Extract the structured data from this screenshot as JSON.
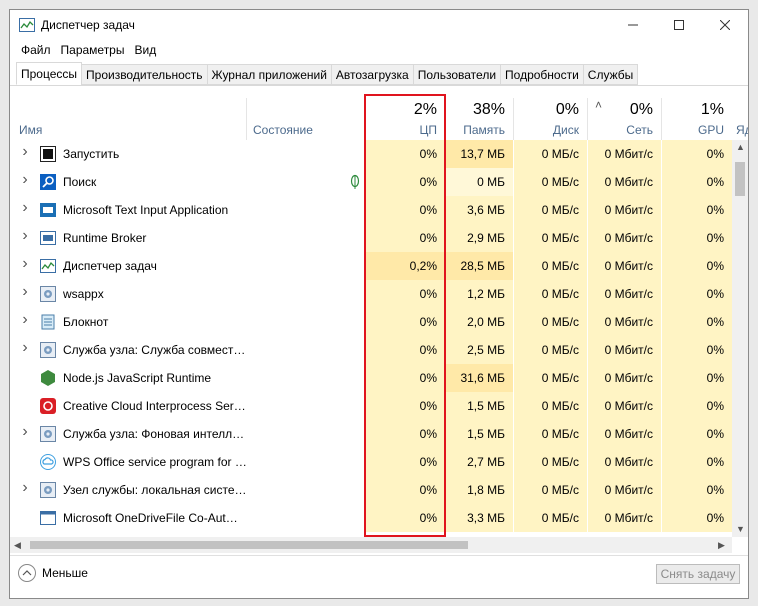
{
  "window": {
    "title": "Диспетчер задач"
  },
  "menu": [
    "Файл",
    "Параметры",
    "Вид"
  ],
  "tabs": [
    "Процессы",
    "Производительность",
    "Журнал приложений",
    "Автозагрузка",
    "Пользователи",
    "Подробности",
    "Службы"
  ],
  "columns": {
    "name": "Имя",
    "status": "Состояние",
    "cpu": {
      "pct": "2%",
      "label": "ЦП"
    },
    "memory": {
      "pct": "38%",
      "label": "Память"
    },
    "disk": {
      "pct": "0%",
      "label": "Диск"
    },
    "network": {
      "pct": "0%",
      "label": "Сеть"
    },
    "gpu": {
      "pct": "1%",
      "label": "GPU"
    },
    "gpu_engine_partial": "Яд"
  },
  "processes": [
    {
      "name": "Запустить",
      "expandable": true,
      "icon": "start-icon",
      "cpu": "0%",
      "memory": "13,7 МБ",
      "disk": "0 МБ/с",
      "network": "0 Мбит/с",
      "gpu": "0%"
    },
    {
      "name": "Поиск",
      "expandable": true,
      "icon": "search-app-icon",
      "suspended": true,
      "cpu": "0%",
      "memory": "0 МБ",
      "disk": "0 МБ/с",
      "network": "0 Мбит/с",
      "gpu": "0%"
    },
    {
      "name": "Microsoft Text Input Application",
      "expandable": true,
      "icon": "text-input-icon",
      "cpu": "0%",
      "memory": "3,6 МБ",
      "disk": "0 МБ/с",
      "network": "0 Мбит/с",
      "gpu": "0%"
    },
    {
      "name": "Runtime Broker",
      "expandable": true,
      "icon": "runtime-broker-icon",
      "cpu": "0%",
      "memory": "2,9 МБ",
      "disk": "0 МБ/с",
      "network": "0 Мбит/с",
      "gpu": "0%"
    },
    {
      "name": "Диспетчер задач",
      "expandable": true,
      "icon": "task-manager-icon",
      "cpu": "0,2%",
      "memory": "28,5 МБ",
      "disk": "0 МБ/с",
      "network": "0 Мбит/с",
      "gpu": "0%"
    },
    {
      "name": "wsappx",
      "expandable": true,
      "icon": "gear-icon",
      "cpu": "0%",
      "memory": "1,2 МБ",
      "disk": "0 МБ/с",
      "network": "0 Мбит/с",
      "gpu": "0%"
    },
    {
      "name": "Блокнот",
      "expandable": true,
      "icon": "notepad-icon",
      "cpu": "0%",
      "memory": "2,0 МБ",
      "disk": "0 МБ/с",
      "network": "0 Мбит/с",
      "gpu": "0%"
    },
    {
      "name": "Служба узла: Служба совмест…",
      "expandable": true,
      "icon": "gear-icon",
      "cpu": "0%",
      "memory": "2,5 МБ",
      "disk": "0 МБ/с",
      "network": "0 Мбит/с",
      "gpu": "0%"
    },
    {
      "name": "Node.js JavaScript Runtime",
      "expandable": false,
      "icon": "nodejs-icon",
      "cpu": "0%",
      "memory": "31,6 МБ",
      "disk": "0 МБ/с",
      "network": "0 Мбит/с",
      "gpu": "0%"
    },
    {
      "name": "Creative Cloud Interprocess Ser…",
      "expandable": false,
      "icon": "creative-cloud-icon",
      "cpu": "0%",
      "memory": "1,5 МБ",
      "disk": "0 МБ/с",
      "network": "0 Мбит/с",
      "gpu": "0%"
    },
    {
      "name": "Служба узла: Фоновая интелл…",
      "expandable": true,
      "icon": "gear-icon",
      "cpu": "0%",
      "memory": "1,5 МБ",
      "disk": "0 МБ/с",
      "network": "0 Мбит/с",
      "gpu": "0%"
    },
    {
      "name": "WPS Office service program for …",
      "expandable": false,
      "icon": "wps-cloud-icon",
      "cpu": "0%",
      "memory": "2,7 МБ",
      "disk": "0 МБ/с",
      "network": "0 Мбит/с",
      "gpu": "0%"
    },
    {
      "name": "Узел службы: локальная систе…",
      "expandable": true,
      "icon": "gear-icon",
      "cpu": "0%",
      "memory": "1,8 МБ",
      "disk": "0 МБ/с",
      "network": "0 Мбит/с",
      "gpu": "0%"
    },
    {
      "name": "Microsoft OneDriveFile Co-Aut…",
      "expandable": false,
      "icon": "window-app-icon",
      "cpu": "0%",
      "memory": "3,3 МБ",
      "disk": "0 МБ/с",
      "network": "0 Мбит/с",
      "gpu": "0%"
    }
  ],
  "footer": {
    "less_label": "Меньше",
    "end_task_label": "Снять задачу"
  },
  "colors": {
    "highlight": "#e0141e",
    "heat_light": "#fff4c4",
    "heat_dark": "#ffe9a8",
    "header_label": "#4c6a8c"
  }
}
